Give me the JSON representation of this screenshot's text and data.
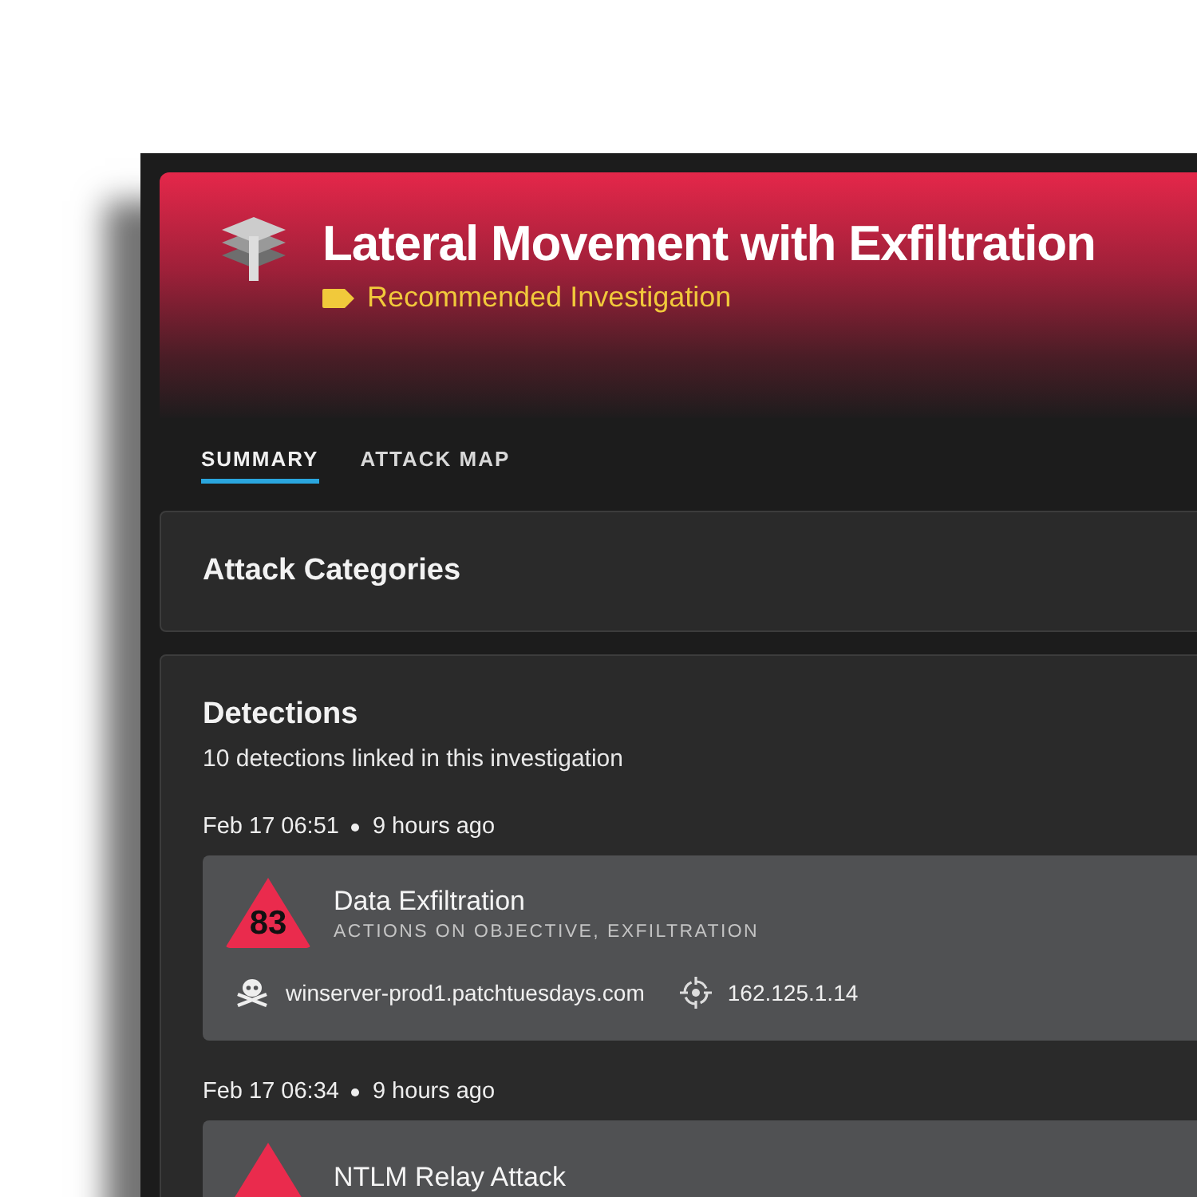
{
  "header": {
    "title": "Lateral Movement with Exfiltration",
    "tag": "Recommended Investigation"
  },
  "tabs": [
    {
      "label": "SUMMARY",
      "selected": true
    },
    {
      "label": "ATTACK MAP",
      "selected": false
    }
  ],
  "attack_categories": {
    "title": "Attack Categories"
  },
  "detections": {
    "title": "Detections",
    "subtitle": "10 detections linked in this investigation",
    "items": [
      {
        "date": "Feb 17 06:51",
        "ago": "9 hours ago",
        "score": "83",
        "name": "Data Exfiltration",
        "categories": "ACTIONS ON OBJECTIVE, EXFILTRATION",
        "host": "winserver-prod1.patchtuesdays.com",
        "target": "162.125.1.14"
      },
      {
        "date": "Feb 17 06:34",
        "ago": "9 hours ago",
        "name": "NTLM Relay Attack"
      }
    ]
  }
}
